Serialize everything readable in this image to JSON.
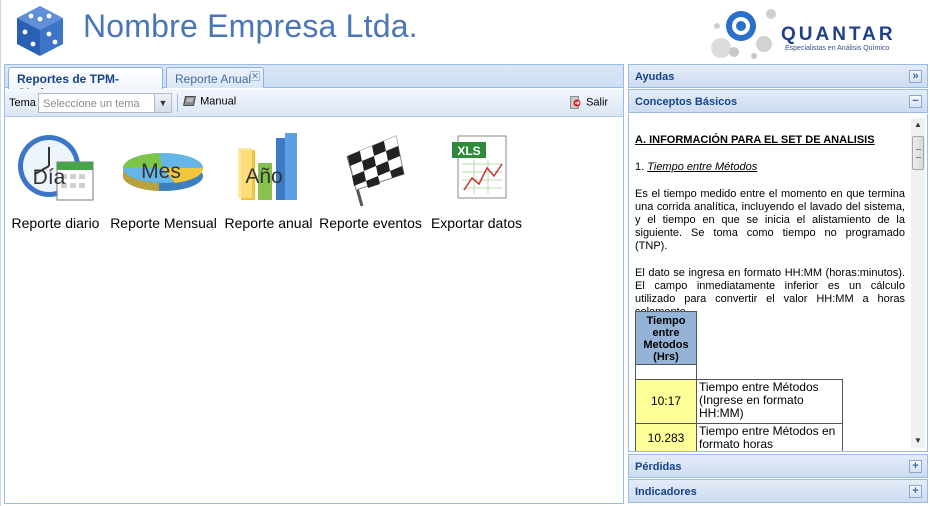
{
  "header": {
    "company_name": "Nombre Empresa Ltda.",
    "brand_name": "QUANTAR",
    "brand_tagline": "Especialistas en Análisis Químico"
  },
  "tabs": [
    {
      "label": "Reportes de TPM-QLabs",
      "active": true
    },
    {
      "label": "Reporte Anual",
      "active": false,
      "closable": true
    }
  ],
  "toolbar": {
    "tema_label": "Tema",
    "tema_placeholder": "Seleccione un tema",
    "manual_label": "Manual",
    "salir_label": "Salir"
  },
  "icons": [
    {
      "label": "Reporte diario",
      "overlay": "Día",
      "icon": "clock-calendar-icon"
    },
    {
      "label": "Reporte Mensual",
      "overlay": "Mes",
      "icon": "pie-chart-icon"
    },
    {
      "label": "Reporte anual",
      "overlay": "Año",
      "icon": "bar-chart-icon"
    },
    {
      "label": "Reporte eventos",
      "icon": "checkered-flag-icon"
    },
    {
      "label": "Exportar datos",
      "overlay": "XLS",
      "icon": "spreadsheet-icon"
    }
  ],
  "accordion": {
    "ayudas": "Ayudas",
    "conceptos": "Conceptos Básicos",
    "perdidas": "Pérdidas",
    "indicadores": "Indicadores"
  },
  "content": {
    "section_lead": "A.",
    "section_title": "INFORMACIÓN PARA EL SET DE ANALISIS",
    "item_num": "1.",
    "item_title": "Tiempo entre Métodos",
    "p1": "Es el tiempo medido entre el momento en que termina una corrida analítica, incluyendo el lavado del sistema, y el tiempo en que se inicia el alistamiento de la siguiente. Se toma como tiempo no programado (TNP).",
    "p2": "El dato se ingresa en formato HH:MM (horas:minutos). El campo inmediatamente inferior es un cálculo utilizado para convertir el valor HH:MM a horas solamente.",
    "table_header": "Tiempo entre Metodos (Hrs)",
    "row1_value": "10:17",
    "row1_desc": "Tiempo entre Métodos (Ingrese en formato HH:MM)",
    "row2_value": "10.283",
    "row2_desc": "Tiempo entre Métodos en formato horas"
  }
}
